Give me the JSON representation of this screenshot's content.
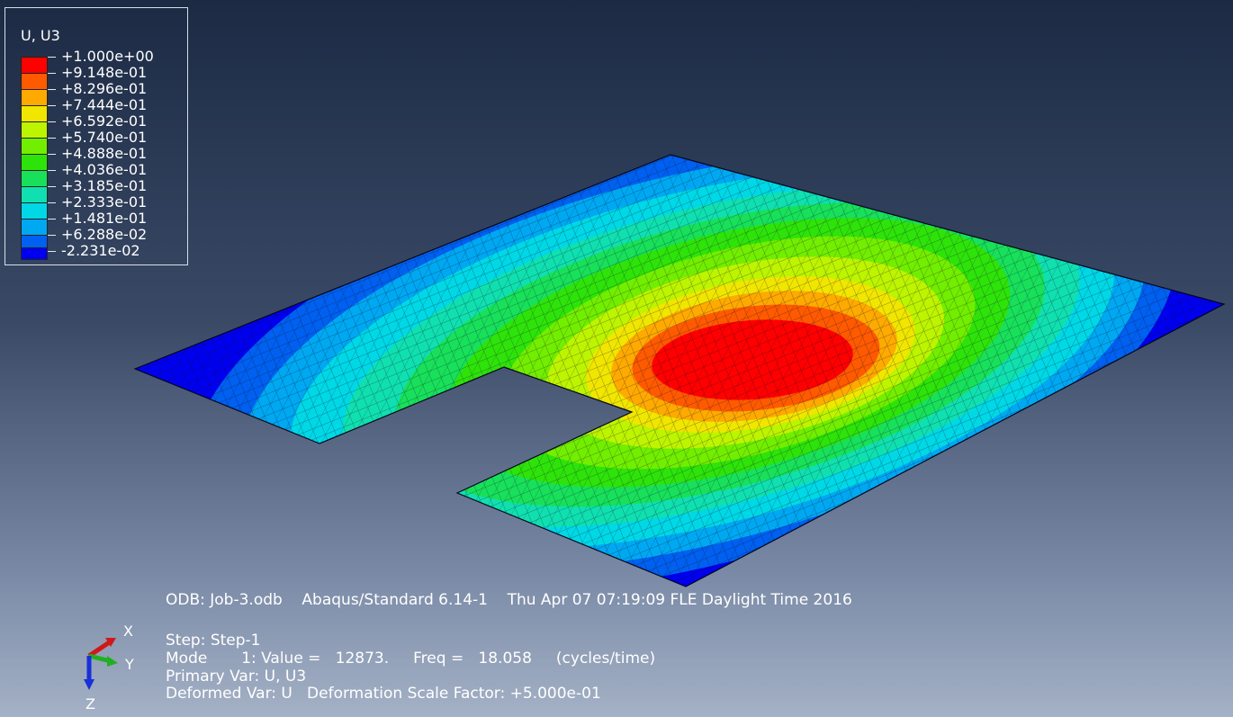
{
  "legend": {
    "title": "U, U3",
    "levels": [
      {
        "label": "+1.000e+00",
        "color": "#ff0000"
      },
      {
        "label": "+9.148e-01",
        "color": "#ff5a00"
      },
      {
        "label": "+8.296e-01",
        "color": "#ffaa00"
      },
      {
        "label": "+7.444e-01",
        "color": "#f0e600"
      },
      {
        "label": "+6.592e-01",
        "color": "#bdf400"
      },
      {
        "label": "+5.740e-01",
        "color": "#72ee00"
      },
      {
        "label": "+4.888e-01",
        "color": "#2ee30a"
      },
      {
        "label": "+4.036e-01",
        "color": "#18e05a"
      },
      {
        "label": "+3.185e-01",
        "color": "#10e0b0"
      },
      {
        "label": "+2.333e-01",
        "color": "#00d8e6"
      },
      {
        "label": "+1.481e-01",
        "color": "#00a8f2"
      },
      {
        "label": "+6.288e-02",
        "color": "#0060f0"
      },
      {
        "label": "-2.231e-02",
        "color": "#0000f0"
      }
    ]
  },
  "info": {
    "odb_line": "ODB: Job-3.odb    Abaqus/Standard 6.14-1    Thu Apr 07 07:19:09 FLE Daylight Time 2016",
    "step_line": "Step: Step-1",
    "mode_line": "Mode       1: Value =   12873.     Freq =   18.058     (cycles/time)",
    "primary_line": "Primary Var: U, U3",
    "deformed_line": "Deformed Var: U   Deformation Scale Factor: +5.000e-01"
  },
  "triad": {
    "x_label": "X",
    "y_label": "Y",
    "z_label": "Z",
    "x_color": "#d01818",
    "y_color": "#20b020",
    "z_color": "#1830d8"
  }
}
